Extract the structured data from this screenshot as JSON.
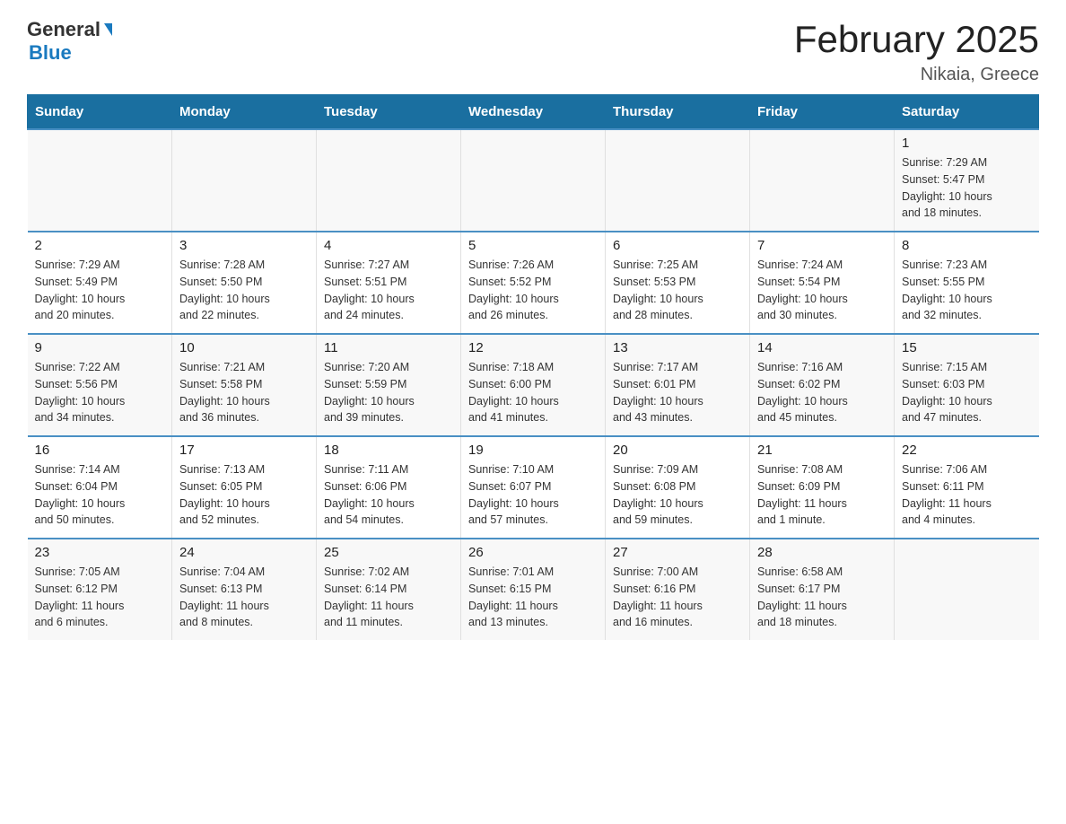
{
  "header": {
    "logo_general": "General",
    "logo_blue": "Blue",
    "title": "February 2025",
    "subtitle": "Nikaia, Greece"
  },
  "days_of_week": [
    "Sunday",
    "Monday",
    "Tuesday",
    "Wednesday",
    "Thursday",
    "Friday",
    "Saturday"
  ],
  "weeks": [
    {
      "days": [
        {
          "number": "",
          "info": "",
          "empty": true
        },
        {
          "number": "",
          "info": "",
          "empty": true
        },
        {
          "number": "",
          "info": "",
          "empty": true
        },
        {
          "number": "",
          "info": "",
          "empty": true
        },
        {
          "number": "",
          "info": "",
          "empty": true
        },
        {
          "number": "",
          "info": "",
          "empty": true
        },
        {
          "number": "1",
          "info": "Sunrise: 7:29 AM\nSunset: 5:47 PM\nDaylight: 10 hours\nand 18 minutes.",
          "empty": false
        }
      ]
    },
    {
      "days": [
        {
          "number": "2",
          "info": "Sunrise: 7:29 AM\nSunset: 5:49 PM\nDaylight: 10 hours\nand 20 minutes.",
          "empty": false
        },
        {
          "number": "3",
          "info": "Sunrise: 7:28 AM\nSunset: 5:50 PM\nDaylight: 10 hours\nand 22 minutes.",
          "empty": false
        },
        {
          "number": "4",
          "info": "Sunrise: 7:27 AM\nSunset: 5:51 PM\nDaylight: 10 hours\nand 24 minutes.",
          "empty": false
        },
        {
          "number": "5",
          "info": "Sunrise: 7:26 AM\nSunset: 5:52 PM\nDaylight: 10 hours\nand 26 minutes.",
          "empty": false
        },
        {
          "number": "6",
          "info": "Sunrise: 7:25 AM\nSunset: 5:53 PM\nDaylight: 10 hours\nand 28 minutes.",
          "empty": false
        },
        {
          "number": "7",
          "info": "Sunrise: 7:24 AM\nSunset: 5:54 PM\nDaylight: 10 hours\nand 30 minutes.",
          "empty": false
        },
        {
          "number": "8",
          "info": "Sunrise: 7:23 AM\nSunset: 5:55 PM\nDaylight: 10 hours\nand 32 minutes.",
          "empty": false
        }
      ]
    },
    {
      "days": [
        {
          "number": "9",
          "info": "Sunrise: 7:22 AM\nSunset: 5:56 PM\nDaylight: 10 hours\nand 34 minutes.",
          "empty": false
        },
        {
          "number": "10",
          "info": "Sunrise: 7:21 AM\nSunset: 5:58 PM\nDaylight: 10 hours\nand 36 minutes.",
          "empty": false
        },
        {
          "number": "11",
          "info": "Sunrise: 7:20 AM\nSunset: 5:59 PM\nDaylight: 10 hours\nand 39 minutes.",
          "empty": false
        },
        {
          "number": "12",
          "info": "Sunrise: 7:18 AM\nSunset: 6:00 PM\nDaylight: 10 hours\nand 41 minutes.",
          "empty": false
        },
        {
          "number": "13",
          "info": "Sunrise: 7:17 AM\nSunset: 6:01 PM\nDaylight: 10 hours\nand 43 minutes.",
          "empty": false
        },
        {
          "number": "14",
          "info": "Sunrise: 7:16 AM\nSunset: 6:02 PM\nDaylight: 10 hours\nand 45 minutes.",
          "empty": false
        },
        {
          "number": "15",
          "info": "Sunrise: 7:15 AM\nSunset: 6:03 PM\nDaylight: 10 hours\nand 47 minutes.",
          "empty": false
        }
      ]
    },
    {
      "days": [
        {
          "number": "16",
          "info": "Sunrise: 7:14 AM\nSunset: 6:04 PM\nDaylight: 10 hours\nand 50 minutes.",
          "empty": false
        },
        {
          "number": "17",
          "info": "Sunrise: 7:13 AM\nSunset: 6:05 PM\nDaylight: 10 hours\nand 52 minutes.",
          "empty": false
        },
        {
          "number": "18",
          "info": "Sunrise: 7:11 AM\nSunset: 6:06 PM\nDaylight: 10 hours\nand 54 minutes.",
          "empty": false
        },
        {
          "number": "19",
          "info": "Sunrise: 7:10 AM\nSunset: 6:07 PM\nDaylight: 10 hours\nand 57 minutes.",
          "empty": false
        },
        {
          "number": "20",
          "info": "Sunrise: 7:09 AM\nSunset: 6:08 PM\nDaylight: 10 hours\nand 59 minutes.",
          "empty": false
        },
        {
          "number": "21",
          "info": "Sunrise: 7:08 AM\nSunset: 6:09 PM\nDaylight: 11 hours\nand 1 minute.",
          "empty": false
        },
        {
          "number": "22",
          "info": "Sunrise: 7:06 AM\nSunset: 6:11 PM\nDaylight: 11 hours\nand 4 minutes.",
          "empty": false
        }
      ]
    },
    {
      "days": [
        {
          "number": "23",
          "info": "Sunrise: 7:05 AM\nSunset: 6:12 PM\nDaylight: 11 hours\nand 6 minutes.",
          "empty": false
        },
        {
          "number": "24",
          "info": "Sunrise: 7:04 AM\nSunset: 6:13 PM\nDaylight: 11 hours\nand 8 minutes.",
          "empty": false
        },
        {
          "number": "25",
          "info": "Sunrise: 7:02 AM\nSunset: 6:14 PM\nDaylight: 11 hours\nand 11 minutes.",
          "empty": false
        },
        {
          "number": "26",
          "info": "Sunrise: 7:01 AM\nSunset: 6:15 PM\nDaylight: 11 hours\nand 13 minutes.",
          "empty": false
        },
        {
          "number": "27",
          "info": "Sunrise: 7:00 AM\nSunset: 6:16 PM\nDaylight: 11 hours\nand 16 minutes.",
          "empty": false
        },
        {
          "number": "28",
          "info": "Sunrise: 6:58 AM\nSunset: 6:17 PM\nDaylight: 11 hours\nand 18 minutes.",
          "empty": false
        },
        {
          "number": "",
          "info": "",
          "empty": true
        }
      ]
    }
  ]
}
